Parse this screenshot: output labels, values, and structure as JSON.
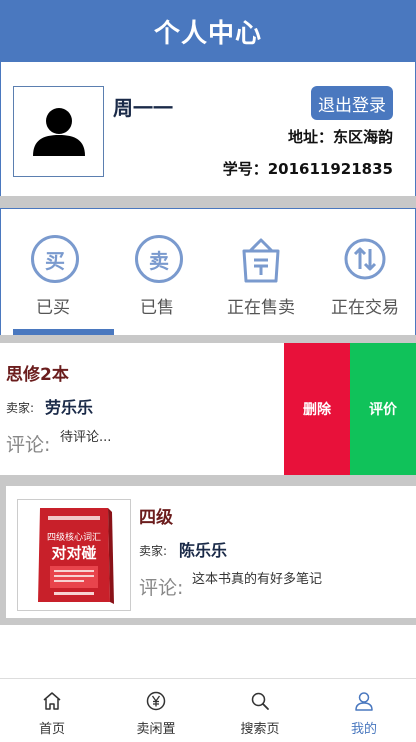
{
  "header": {
    "title": "个人中心"
  },
  "profile": {
    "name": "周一一",
    "logout_label": "退出登录",
    "address": "地址：东区海韵",
    "student_id": "学号：201611921835"
  },
  "tabs": [
    {
      "glyph": "买",
      "label": "已买"
    },
    {
      "glyph": "卖",
      "label": "已售"
    },
    {
      "label": "正在售卖"
    },
    {
      "label": "正在交易"
    }
  ],
  "orders": [
    {
      "title": "思修2本",
      "seller_label": "卖家:",
      "seller": "劳乐乐",
      "comment_label": "评论:",
      "comment": "待评论...",
      "delete_label": "删除",
      "rate_label": "评价"
    },
    {
      "title": "四级",
      "seller_label": "卖家:",
      "seller": "陈乐乐",
      "comment_label": "评论:",
      "comment": "这本书真的有好多笔记",
      "cover": {
        "subtitle": "四级核心词汇",
        "title": "对对碰"
      }
    }
  ],
  "bottom_nav": [
    {
      "label": "首页",
      "icon": "home-icon"
    },
    {
      "label": "卖闲置",
      "icon": "yen-icon"
    },
    {
      "label": "搜索页",
      "icon": "search-icon"
    },
    {
      "label": "我的",
      "icon": "user-icon",
      "active": true
    }
  ],
  "colors": {
    "primary": "#4a78bf",
    "delete": "#e8113a",
    "rate": "#10c25a",
    "title_red": "#6b1d1d"
  }
}
